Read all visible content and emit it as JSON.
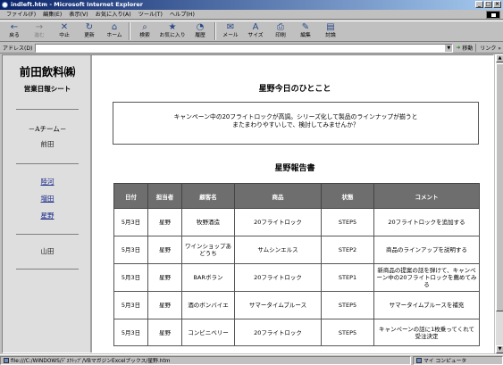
{
  "window": {
    "title": "indleft.htm - Microsoft Internet Explorer",
    "min": "_",
    "max": "□",
    "close": "×"
  },
  "menu": [
    "ファイル(F)",
    "編集(E)",
    "表示(V)",
    "お気に入り(A)",
    "ツール(T)",
    "ヘルプ(H)"
  ],
  "toolbar": [
    {
      "label": "戻る",
      "icon": "←"
    },
    {
      "label": "進む",
      "icon": "→"
    },
    {
      "label": "中止",
      "icon": "✕"
    },
    {
      "label": "更新",
      "icon": "↻"
    },
    {
      "label": "ホーム",
      "icon": "⌂"
    },
    {
      "label": "検索",
      "icon": "⌕"
    },
    {
      "label": "お気に入り",
      "icon": "★"
    },
    {
      "label": "履歴",
      "icon": "◔"
    },
    {
      "label": "メール",
      "icon": "✉"
    },
    {
      "label": "サイズ",
      "icon": "A"
    },
    {
      "label": "印刷",
      "icon": "⎙"
    },
    {
      "label": "編集",
      "icon": "✎"
    },
    {
      "label": "討論",
      "icon": "▤"
    }
  ],
  "address": {
    "label": "アドレス(D)",
    "go": "移動",
    "links": "リンク »"
  },
  "sidebar": {
    "company": "前田飲料㈱",
    "sheet": "営業日報シート",
    "team": "－Aチーム－",
    "current": "前田",
    "members": [
      "陸河",
      "増田",
      "星野"
    ],
    "other": "山田"
  },
  "main": {
    "today_heading": "星野今日のひとこと",
    "comment_line1": "キャンペーン中の20フライトロックが高調。シリーズ化して製品のラインナップが揃うと",
    "comment_line2": "またまわりやすいしで、検討してみませんか？",
    "report_heading": "星野報告書",
    "columns": [
      "日付",
      "担当者",
      "顧客名",
      "商品",
      "状態",
      "コメント"
    ],
    "rows": [
      [
        "5月3日",
        "星野",
        "牧野酒造",
        "20フライトロック",
        "STEP5",
        "20フライトロックを追加する"
      ],
      [
        "5月3日",
        "星野",
        "ワインショップあどうち",
        "サムシンエルス",
        "STEP2",
        "商品のラインアップを説明する"
      ],
      [
        "5月3日",
        "星野",
        "BARボラン",
        "20フライトロック",
        "STEP1",
        "新商品の提案の話を弾けて、キャンペーン中の20フライトロックを薦めてみる"
      ],
      [
        "5月3日",
        "星野",
        "酒のボンバイエ",
        "サマータイムブルース",
        "STEP5",
        "サマータイムブルースを補充"
      ],
      [
        "5月3日",
        "星野",
        "コンビニベリー",
        "20フライトロック",
        "STEP5",
        "キャンペーンの話に1枚乗ってくれて受注決定"
      ]
    ]
  },
  "status": {
    "url": "file:///C:/WINDOWS/ﾃﾞｽｸﾄｯﾌﾟ/VBマガジンExcelブックス/星野.htm",
    "zone": "マイ コンピュータ"
  }
}
